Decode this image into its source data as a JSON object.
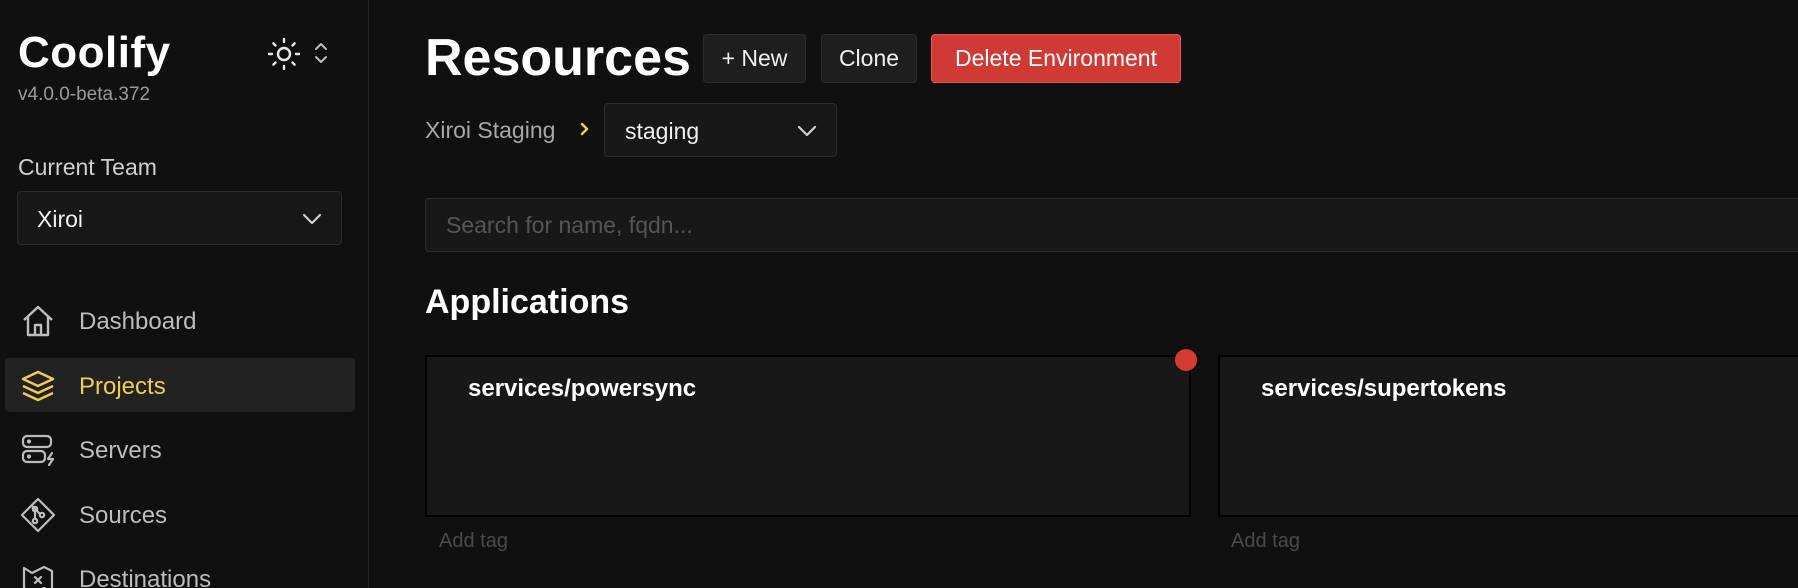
{
  "sidebar": {
    "brand": "Coolify",
    "version": "v4.0.0-beta.372",
    "team_label": "Current Team",
    "team_value": "Xiroi",
    "items": [
      {
        "label": "Dashboard",
        "icon": "home-icon",
        "active": false
      },
      {
        "label": "Projects",
        "icon": "layers-icon",
        "active": true
      },
      {
        "label": "Servers",
        "icon": "server-icon",
        "active": false
      },
      {
        "label": "Sources",
        "icon": "git-icon",
        "active": false
      },
      {
        "label": "Destinations",
        "icon": "destinations-icon",
        "active": false
      }
    ]
  },
  "header": {
    "title": "Resources",
    "new_label": "+ New",
    "clone_label": "Clone",
    "delete_label": "Delete Environment"
  },
  "breadcrumb": {
    "project": "Xiroi Staging",
    "environment": "staging"
  },
  "search": {
    "placeholder": "Search for name, fqdn..."
  },
  "applications": {
    "title": "Applications",
    "items": [
      {
        "name": "services/powersync",
        "add_tag": "Add tag",
        "status_color": "#d43b33"
      },
      {
        "name": "services/supertokens",
        "add_tag": "Add tag"
      }
    ]
  },
  "colors": {
    "accent": "#f2cd55",
    "danger": "#cf3a34",
    "background": "#101010"
  }
}
